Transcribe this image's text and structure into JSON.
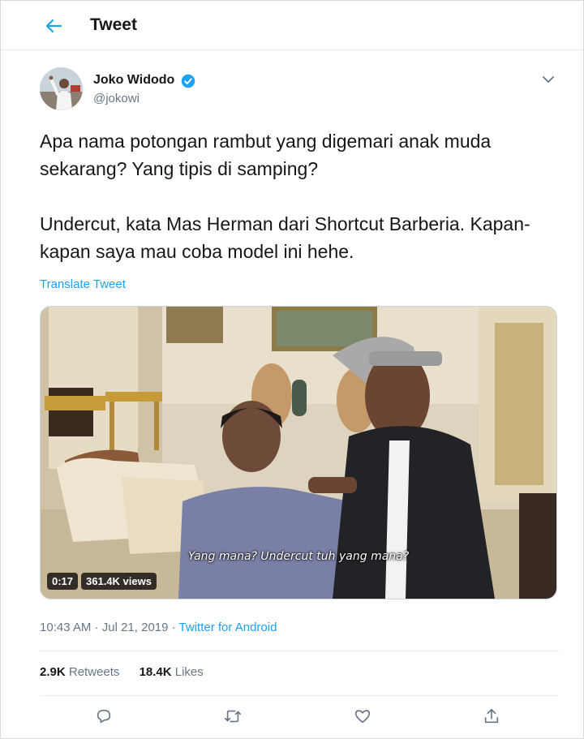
{
  "header": {
    "title": "Tweet",
    "back_icon": "arrow-left-icon"
  },
  "author": {
    "name": "Joko Widodo",
    "handle": "@jokowi",
    "verified": true,
    "verified_icon": "verified-badge-icon"
  },
  "tweet": {
    "paragraph_1": "Apa nama potongan rambut yang digemari anak muda sekarang? Yang tipis di samping?",
    "paragraph_2": "Undercut, kata Mas Herman dari Shortcut Barberia. Kapan-kapan saya mau coba model ini hehe.",
    "translate_label": "Translate Tweet"
  },
  "media": {
    "subtitle": "Yang mana? Undercut tuh yang mana?",
    "duration": "0:17",
    "views": "361.4K views"
  },
  "meta": {
    "time": "10:43 AM",
    "separator_1": " · ",
    "date": "Jul 21, 2019",
    "separator_2": " · ",
    "source": "Twitter for Android"
  },
  "stats": {
    "retweets_count": "2.9K",
    "retweets_label": " Retweets",
    "likes_count": "18.4K",
    "likes_label": " Likes"
  },
  "actions": [
    {
      "name": "reply",
      "icon": "reply-icon"
    },
    {
      "name": "retweet",
      "icon": "retweet-icon"
    },
    {
      "name": "like",
      "icon": "heart-icon"
    },
    {
      "name": "share",
      "icon": "share-icon"
    }
  ],
  "colors": {
    "accent": "#1da1f2",
    "text": "#14171a",
    "secondary": "#657786",
    "divider": "#e6ecf0"
  }
}
